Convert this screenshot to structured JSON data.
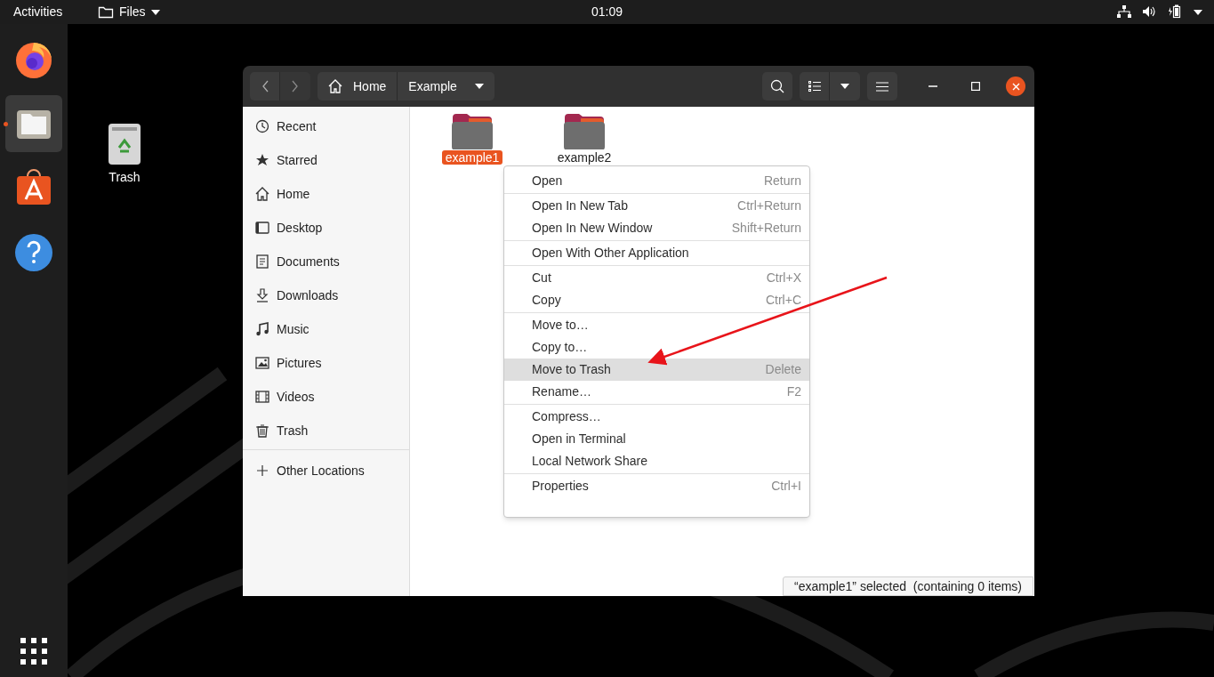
{
  "top_bar": {
    "activities": "Activities",
    "app_menu": "Files",
    "clock": "01:09"
  },
  "dock": {
    "items": [
      {
        "kind": "browser",
        "selected": false,
        "running": false
      },
      {
        "kind": "files",
        "selected": true,
        "running": true
      },
      {
        "kind": "store",
        "selected": false,
        "running": false
      },
      {
        "kind": "help",
        "selected": false,
        "running": false
      }
    ]
  },
  "desktop_icons": [
    {
      "label": "Trash"
    }
  ],
  "window": {
    "path": [
      {
        "label": "Home",
        "kind": "home"
      },
      {
        "label": "Example",
        "kind": "current"
      }
    ],
    "sidebar": {
      "items": [
        {
          "label": "Recent",
          "selected": false
        },
        {
          "label": "Starred",
          "selected": false
        },
        {
          "label": "Home",
          "selected": false
        },
        {
          "label": "Desktop",
          "selected": false
        },
        {
          "label": "Documents",
          "selected": false
        },
        {
          "label": "Downloads",
          "selected": false
        },
        {
          "label": "Music",
          "selected": false
        },
        {
          "label": "Pictures",
          "selected": false
        },
        {
          "label": "Videos",
          "selected": false
        },
        {
          "label": "Trash",
          "selected": false
        }
      ],
      "other": {
        "label": "Other Locations",
        "selected": false
      }
    },
    "files": [
      {
        "name": "example1",
        "selected": true
      },
      {
        "name": "example2",
        "selected": false
      }
    ],
    "context_menu": {
      "groups": [
        [
          {
            "label": "Open",
            "shortcut": "Return",
            "selected": false
          }
        ],
        [
          {
            "label": "Open In New Tab",
            "shortcut": "Ctrl+Return",
            "selected": false
          },
          {
            "label": "Open In New Window",
            "shortcut": "Shift+Return",
            "selected": false
          }
        ],
        [
          {
            "label": "Open With Other Application",
            "selected": false
          }
        ],
        [
          {
            "label": "Cut",
            "shortcut": "Ctrl+X",
            "selected": false
          },
          {
            "label": "Copy",
            "shortcut": "Ctrl+C",
            "selected": false
          }
        ],
        [
          {
            "label": "Move to…",
            "selected": false
          },
          {
            "label": "Copy to…",
            "selected": false
          },
          {
            "label": "Move to Trash",
            "shortcut": "Delete",
            "selected": true
          },
          {
            "label": "Rename…",
            "shortcut": "F2",
            "selected": false
          }
        ],
        [
          {
            "label": "Compress…",
            "selected": false
          },
          {
            "label": "Open in Terminal",
            "selected": false
          },
          {
            "label": "Local Network Share",
            "selected": false
          }
        ],
        [
          {
            "label": "Properties",
            "shortcut": "Ctrl+I",
            "selected": false
          }
        ]
      ]
    },
    "status_bar": "“example1” selected  (containing 0 items)"
  }
}
